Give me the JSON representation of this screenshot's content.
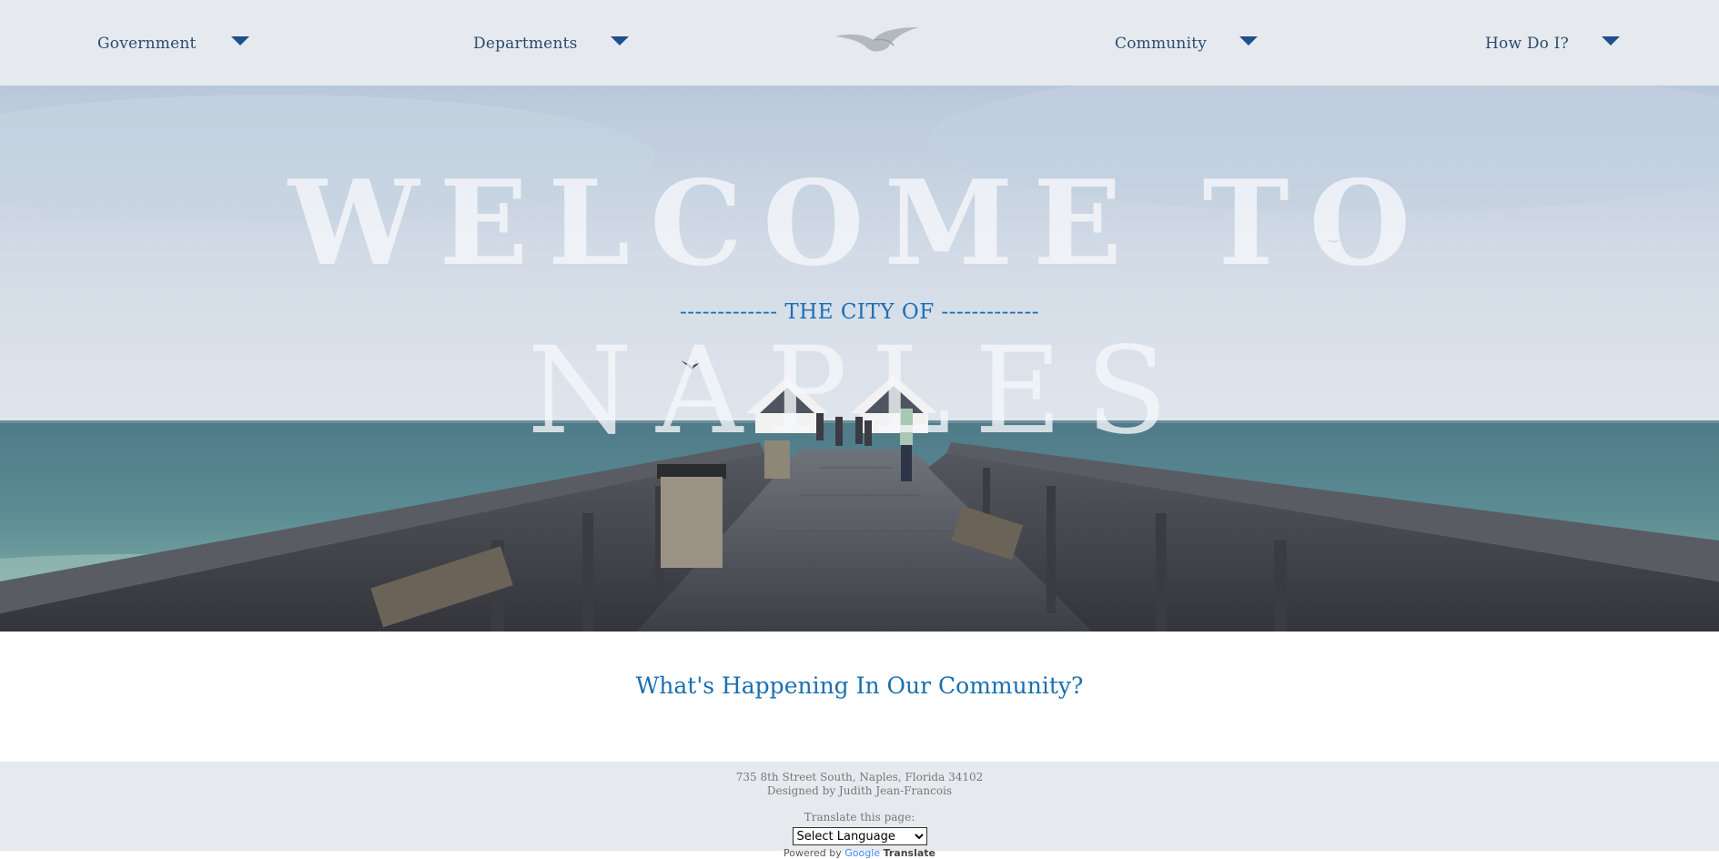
{
  "nav": {
    "items": [
      {
        "label": "Government"
      },
      {
        "label": "Departments"
      },
      {
        "label": "Community"
      },
      {
        "label": "How Do I?"
      }
    ],
    "logo_icon": "seagull-logo-icon",
    "caret_icon": "caret-down-icon"
  },
  "hero": {
    "welcome": "WELCOME TO",
    "subtitle": "------------- THE CITY OF -------------",
    "city": "NAPLES",
    "background": "naples-pier-ocean-photo"
  },
  "community": {
    "heading": "What's Happening In Our Community?"
  },
  "footer": {
    "address": "735 8th Street South, Naples, Florida 34102",
    "designer": "Designed by Judith Jean-Francois",
    "translate_label": "Translate this page:",
    "language_select": "Select Language",
    "powered_by": "Powered by",
    "google": "Google",
    "translate": "Translate"
  },
  "colors": {
    "nav_bg": "#e6eaee",
    "nav_text": "#2b4a6f",
    "accent_blue": "#1a6fb0",
    "caret": "#1f4f8f"
  }
}
